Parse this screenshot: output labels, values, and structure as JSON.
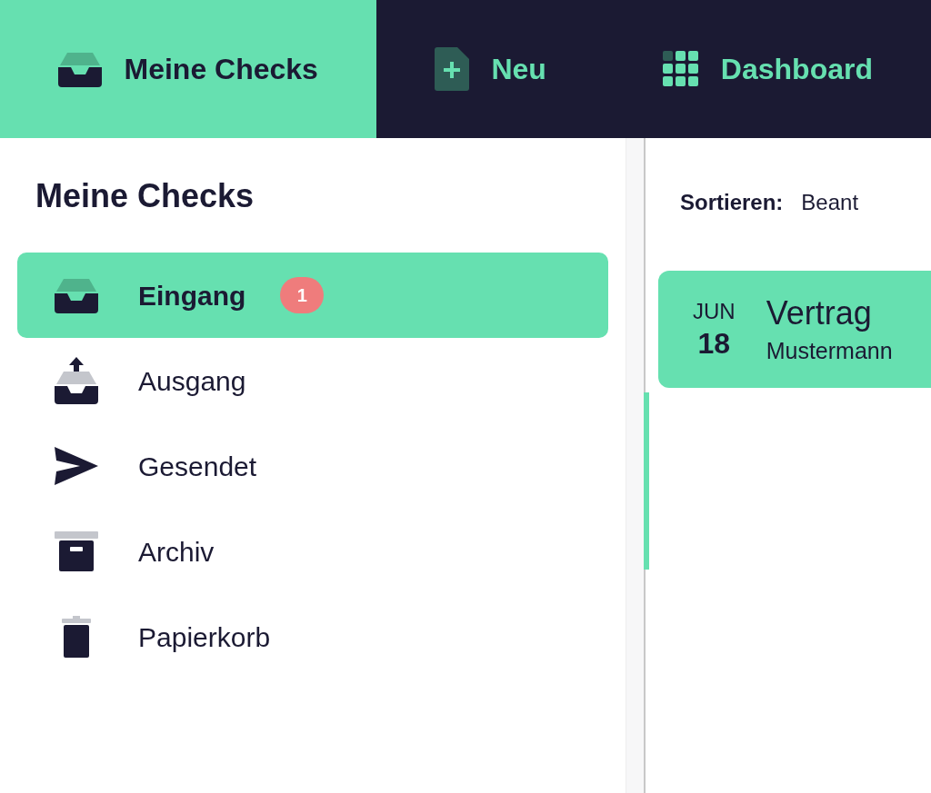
{
  "nav_tabs": [
    {
      "label": "Meine Checks",
      "kind": "inbox",
      "selected": true
    },
    {
      "label": "Neu",
      "kind": "new",
      "selected": false
    },
    {
      "label": "Dashboard",
      "kind": "grid",
      "selected": false
    }
  ],
  "sidebar": {
    "title": "Meine Checks",
    "items": [
      {
        "label": "Eingang",
        "kind": "inbox",
        "selected": true,
        "badge": "1"
      },
      {
        "label": "Ausgang",
        "kind": "outbox",
        "selected": false
      },
      {
        "label": "Gesendet",
        "kind": "send",
        "selected": false
      },
      {
        "label": "Archiv",
        "kind": "archive",
        "selected": false
      },
      {
        "label": "Papierkorb",
        "kind": "trash",
        "selected": false
      }
    ]
  },
  "sort": {
    "label": "Sortieren:",
    "value": "Beant"
  },
  "checks": [
    {
      "month": "JUN",
      "day": "18",
      "title": "Vertrag",
      "sender": "Mustermann",
      "selected": true
    }
  ]
}
